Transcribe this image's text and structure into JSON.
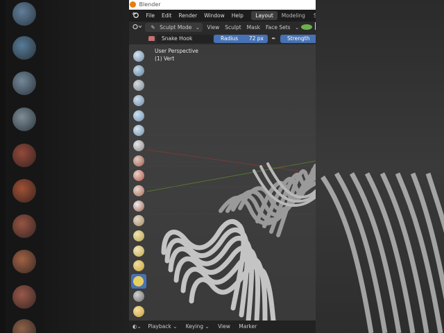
{
  "window": {
    "title": "Blender"
  },
  "menubar": {
    "items": [
      "File",
      "Edit",
      "Render",
      "Window",
      "Help"
    ],
    "workspaces": [
      "Layout",
      "Modeling",
      "Sculpting"
    ],
    "active_workspace": "Layout"
  },
  "header": {
    "mode": "Sculpt Mode",
    "menus": [
      "View",
      "Sculpt",
      "Mask",
      "Face Sets"
    ]
  },
  "tool_settings": {
    "brush_name": "Snake Hook",
    "radius_label": "Radius",
    "radius_value": "72 px",
    "strength_label": "Strength"
  },
  "viewport": {
    "perspective": "User Perspective",
    "object_info": "(1) Vert"
  },
  "toolbar": {
    "tools": [
      "draw",
      "draw-sharp",
      "clay",
      "clay-strips",
      "clay-thumb",
      "layer",
      "inflate",
      "blob",
      "crease",
      "smooth",
      "flatten",
      "fill",
      "scrape",
      "multiplane-scrape",
      "pinch",
      "grab",
      "elastic-deform",
      "snake-hook",
      "thumb",
      "pose"
    ],
    "active_tool": "snake-hook"
  },
  "timeline": {
    "items": [
      "Playback",
      "Keying",
      "View",
      "Marker"
    ]
  }
}
